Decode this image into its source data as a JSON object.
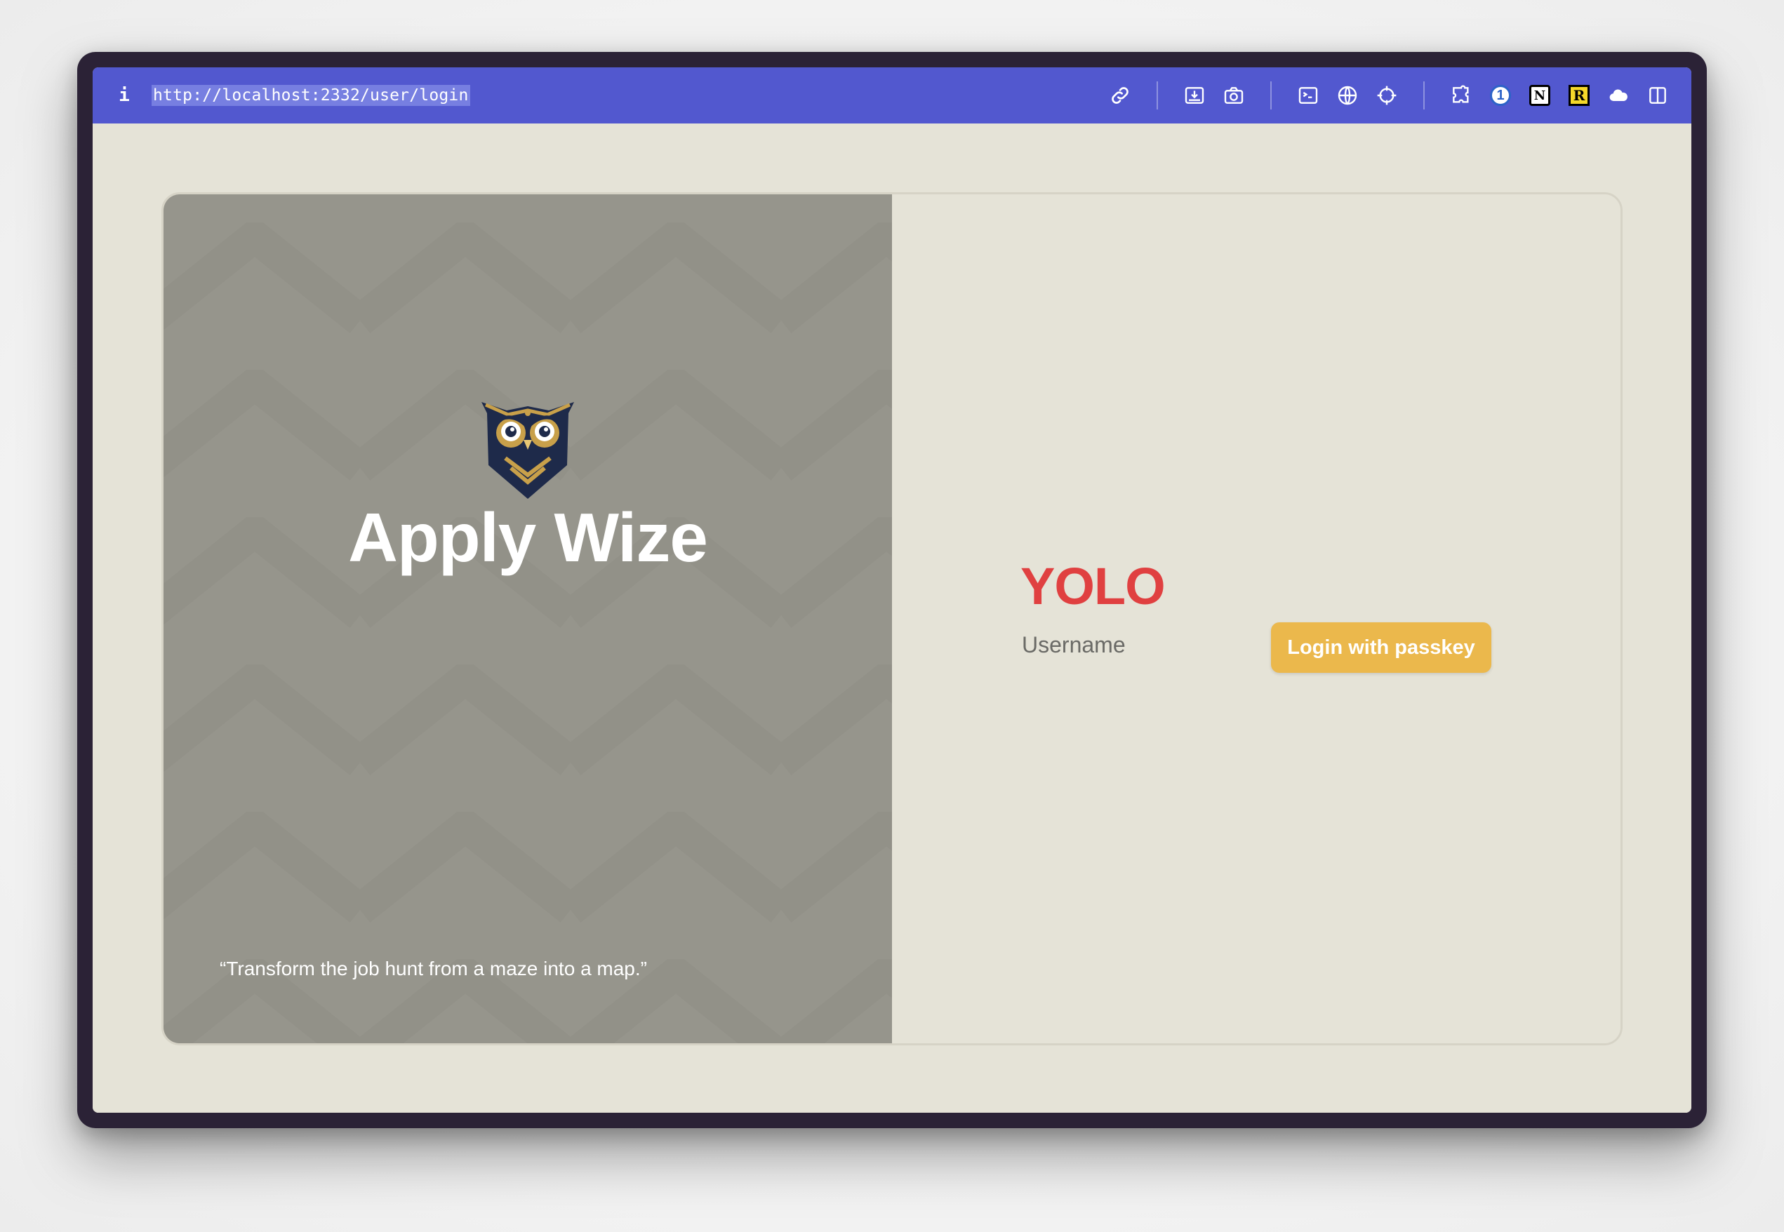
{
  "browser": {
    "url": "http://localhost:2332/user/login",
    "info_label": "i",
    "toolbar_icons": [
      "link-icon",
      "image-download-icon",
      "camera-icon",
      "terminal-icon",
      "globe-icon",
      "crosshair-icon",
      "puzzle-extension-icon",
      "onepassword-icon",
      "notion-icon",
      "r-extension-icon",
      "cloud-icon",
      "sidebar-toggle-icon"
    ],
    "onepassword_letter": "1",
    "notion_letter": "N",
    "r_letter": "R",
    "accent_color": "#5258cf"
  },
  "brand": {
    "title": "Apply Wize",
    "logo": "owl-logo-icon",
    "quote": "“Transform the job hunt from a maze into a map.”",
    "panel_color": "#96958c"
  },
  "login": {
    "heading": "YOLO",
    "username_label": "Username",
    "passkey_button_label": "Login with passkey",
    "heading_color": "#e04040",
    "button_color": "#ebb84c"
  }
}
